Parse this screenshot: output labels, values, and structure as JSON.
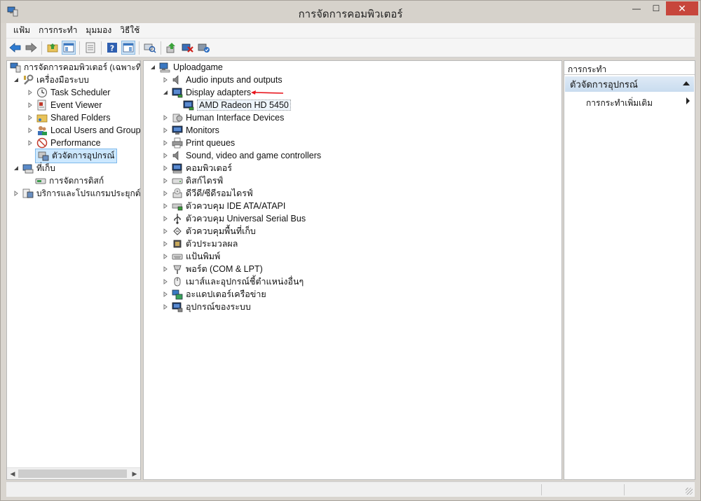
{
  "window": {
    "title": "การจัดการคอมพิวเตอร์",
    "close_glyph": "✕",
    "minimize_glyph": "—",
    "maximize_glyph": "☐"
  },
  "menu": [
    "แฟ้ม",
    "การกระทำ",
    "มุมมอง",
    "วิธีใช้"
  ],
  "toolbar": {
    "icons": [
      "back-arrow-icon",
      "forward-arrow-icon",
      "up-folder-icon",
      "show-hide-tree-icon",
      "properties-icon",
      "help-icon",
      "show-hide-action-pane-icon",
      "scan-hardware-icon",
      "update-driver-icon",
      "uninstall-device-icon",
      "enable-device-icon"
    ]
  },
  "left_tree": {
    "root": "การจัดการคอมพิวเตอร์ (เฉพาะที่)",
    "system_tools": "เครื่องมือระบบ",
    "task_scheduler": "Task Scheduler",
    "event_viewer": "Event Viewer",
    "shared_folders": "Shared Folders",
    "local_users": "Local Users and Groups",
    "performance": "Performance",
    "device_manager": "ตัวจัดการอุปกรณ์",
    "storage": "ที่เก็บ",
    "disk_management": "การจัดการดิสก์",
    "services": "บริการและโปรแกรมประยุกต์"
  },
  "device_tree": {
    "root": "Uploadgame",
    "categories": [
      {
        "label": "Audio inputs and outputs",
        "icon": "speaker-icon",
        "expanded": false
      },
      {
        "label": "Display adapters",
        "icon": "display-adapter-icon",
        "expanded": true
      },
      {
        "label": "Human Interface Devices",
        "icon": "hid-icon",
        "expanded": false
      },
      {
        "label": "Monitors",
        "icon": "monitor-icon",
        "expanded": false
      },
      {
        "label": "Print queues",
        "icon": "printer-icon",
        "expanded": false
      },
      {
        "label": "Sound, video and game controllers",
        "icon": "speaker-icon",
        "expanded": false
      },
      {
        "label": "คอมพิวเตอร์",
        "icon": "computer-icon",
        "expanded": false
      },
      {
        "label": "ดิสก์ไดรฟ์",
        "icon": "disk-drive-icon",
        "expanded": false
      },
      {
        "label": "ดีวีดี/ซีดีรอมไดรฟ์",
        "icon": "dvd-drive-icon",
        "expanded": false
      },
      {
        "label": "ตัวควบคุม IDE ATA/ATAPI",
        "icon": "ide-controller-icon",
        "expanded": false
      },
      {
        "label": "ตัวควบคุม Universal Serial Bus",
        "icon": "usb-icon",
        "expanded": false
      },
      {
        "label": "ตัวควบคุมพื้นที่เก็บ",
        "icon": "storage-controller-icon",
        "expanded": false
      },
      {
        "label": "ตัวประมวลผล",
        "icon": "processor-icon",
        "expanded": false
      },
      {
        "label": "แป้นพิมพ์",
        "icon": "keyboard-icon",
        "expanded": false
      },
      {
        "label": "พอร์ต (COM & LPT)",
        "icon": "port-icon",
        "expanded": false
      },
      {
        "label": "เมาส์และอุปกรณ์ชี้ตำแหน่งอื่นๆ",
        "icon": "mouse-icon",
        "expanded": false
      },
      {
        "label": "อะแดปเตอร์เครือข่าย",
        "icon": "network-adapter-icon",
        "expanded": false
      },
      {
        "label": "อุปกรณ์ของระบบ",
        "icon": "system-device-icon",
        "expanded": false
      }
    ],
    "child_device": "AMD Radeon HD 5450"
  },
  "actions": {
    "header": "การกระทำ",
    "section": "ตัวจัดการอุปกรณ์",
    "more_actions": "การกระทำเพิ่มเติม"
  },
  "colors": {
    "annotation_arrow": "#e8131b",
    "selection_bg": "#cce8ff",
    "close_button": "#c7463c"
  }
}
